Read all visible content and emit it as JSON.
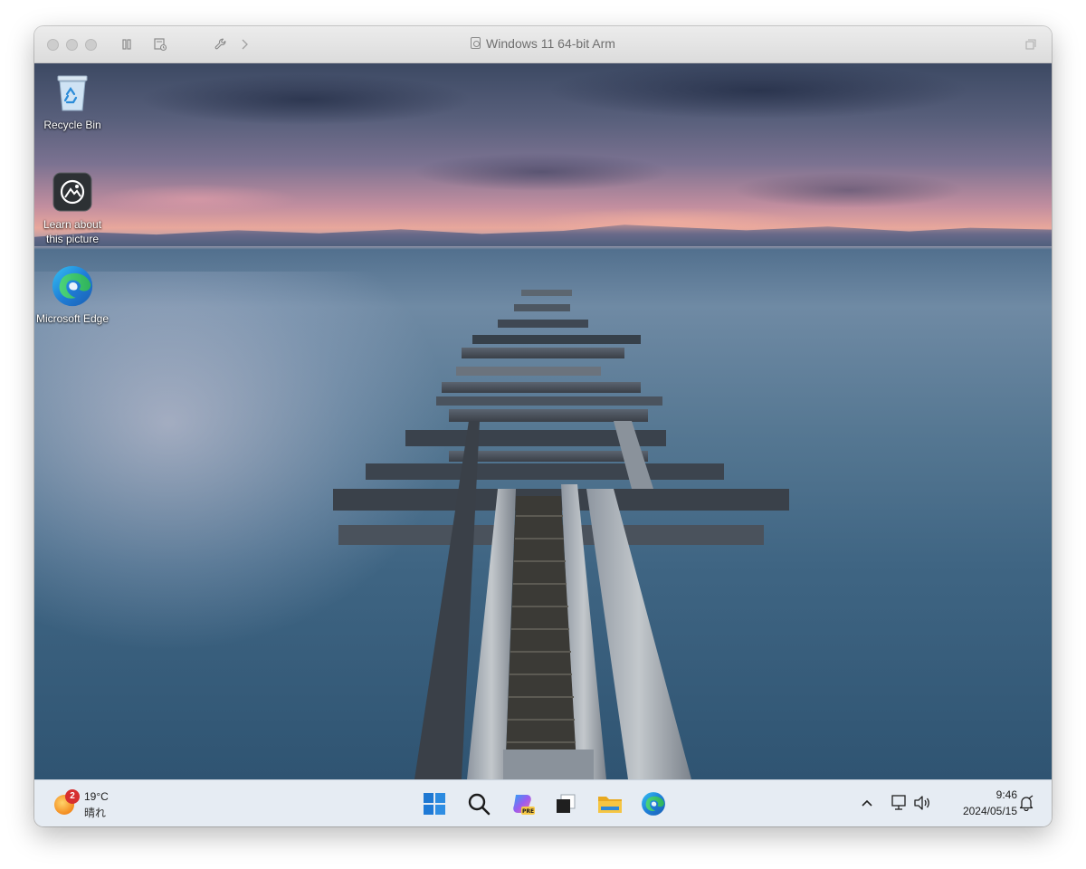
{
  "window": {
    "title": "Windows 11 64-bit Arm"
  },
  "titlebar_icons": [
    "pause-icon",
    "snapshot-icon",
    "wrench-icon",
    "chevron-right-icon",
    "fullscreen-icon"
  ],
  "desktop_icons": [
    {
      "label": "Recycle Bin",
      "icon": "recycle-bin-icon"
    },
    {
      "label": "Learn about this picture",
      "icon": "learn-about-picture-icon"
    },
    {
      "label": "Microsoft Edge",
      "icon": "edge-icon"
    }
  ],
  "taskbar": {
    "weather": {
      "temp": "19°C",
      "condition": "晴れ",
      "badge": "2"
    },
    "apps": [
      {
        "name": "start",
        "icon": "windows-logo-icon"
      },
      {
        "name": "search",
        "icon": "search-icon"
      },
      {
        "name": "copilot",
        "icon": "copilot-icon",
        "badge": "PRE"
      },
      {
        "name": "task-view",
        "icon": "task-view-icon"
      },
      {
        "name": "file-explorer",
        "icon": "folder-icon"
      },
      {
        "name": "edge",
        "icon": "edge-icon"
      }
    ],
    "tray": {
      "icons": [
        "chevron-up-icon",
        "network-icon",
        "volume-icon",
        "notification-icon"
      ],
      "time": "9:46",
      "date": "2024/05/15"
    }
  },
  "colors": {
    "taskbar_bg": "#e6ecf3",
    "titlebar_bg": "#e3e3e3",
    "title_text": "#6f6f6f",
    "windows_blue": "#1e78d2",
    "folder_yellow": "#f5c542",
    "badge_red": "#d62f2f"
  }
}
